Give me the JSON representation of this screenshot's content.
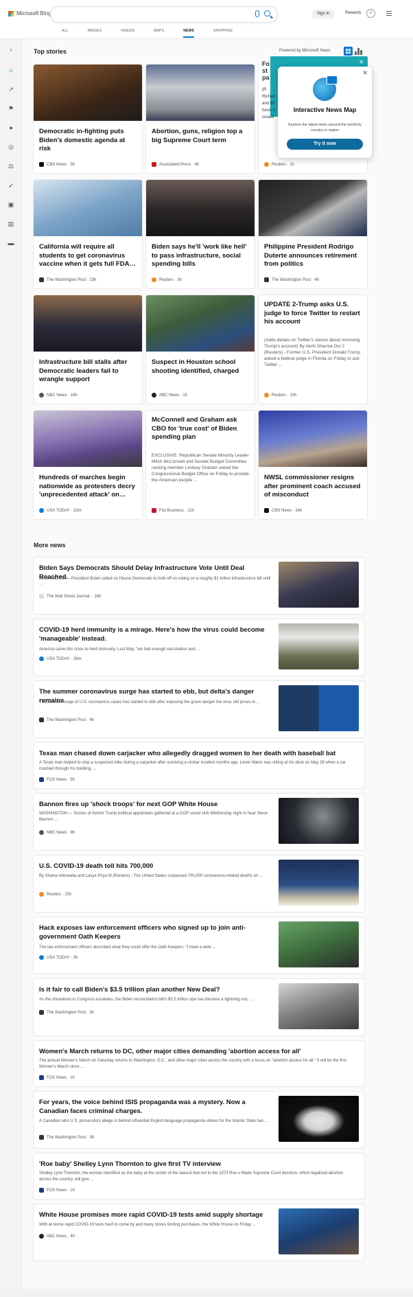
{
  "header": {
    "logo": "Microsoft Bing",
    "signin": "Sign in",
    "rewards": "Rewards",
    "tabs": [
      "ALL",
      "IMAGES",
      "VIDEOS",
      "MAPS",
      "NEWS",
      "SHOPPING"
    ],
    "active_tab": "NEWS"
  },
  "top": {
    "title": "Top stories",
    "powered": "Powered by Microsoft News"
  },
  "popup": {
    "title": "Interactive News Map",
    "desc": "Explore the latest news around the world by country or region",
    "button": "Try it now"
  },
  "teal": {
    "fragments": [
      "Fo",
      "st",
      "pa",
      "(R",
      "Richan",
      "and $5",
      "funds c",
      "issued"
    ]
  },
  "cards": [
    {
      "title": "Democratic in-fighting puts Biden's domestic agenda at risk",
      "source": "CBS News · 3h"
    },
    {
      "title": "Abortion, guns, religion top a big Supreme Court term",
      "source": "Associated Press · 4h"
    },
    {
      "title": "",
      "source": "Reuters · 1h"
    },
    {
      "title": "California will require all students to get coronavirus vaccine when it gets full FDA…",
      "source": "The Washington Post · 23h"
    },
    {
      "title": "Biden says he'll 'work like hell' to pass infrastructure, social spending bills",
      "source": "Reuters · 3h"
    },
    {
      "title": "Philippine President Rodrigo Duterte announces retirement from politics",
      "source": "The Washington Post · 4h"
    },
    {
      "title": "Infrastructure bill stalls after Democratic leaders fail to wrangle support",
      "source": "NBC News · 16h"
    },
    {
      "title": "Suspect in Houston school shooting identified, charged",
      "source": "ABC News · 1h"
    },
    {
      "title": "UPDATE 2-Trump asks U.S. judge to force Twitter to restart his account",
      "snippet": "(Adds details on Twitter's stance about removing Trump's account) By Akriti Sharma Oct 2 (Reuters) - Former U.S. President Donald Trump asked a federal judge in Florida on Friday to ask Twitter ...",
      "source": "Reuters · 10h"
    },
    {
      "title": "Hundreds of marches begin nationwide as protesters decry 'unprecedented attack' on…",
      "source": "USA TODAY · 22m"
    },
    {
      "title": "McConnell and Graham ask CBO for 'true cost' of Biden spending plan",
      "snippet": "EXCLUSIVE: Republican Senate Minority Leader Mitch McConnell and Senate Budget Committee ranking member Lindsey Graham asked the Congressional Budget Office on Friday to provide the American people ...",
      "source": "Fox Business · 21h"
    },
    {
      "title": "NWSL commissioner resigns after prominent coach accused of misconduct",
      "source": "CBS News · 14h"
    }
  ],
  "more": {
    "title": "More news",
    "items": [
      {
        "title": "Biden Says Democrats Should Delay Infrastructure Vote Until Deal Reached",
        "snippet": "WASHINGTON—President Biden called on House Democrats to hold off on voting on a roughly $1 trillion infrastructure bill until ...",
        "source": "The Wall Street Journal. · 16h"
      },
      {
        "title": "COVID-19 herd immunity is a mirage. Here's how the virus could become 'manageable' instead.",
        "snippet": "America came this close to herd immunity. Last May, \"we had enough vaccination and ...",
        "source": "USA TODAY · 28m"
      },
      {
        "title": "The summer coronavirus surge has started to ebb, but delta's danger remains",
        "snippet": "The summer surge of U.S. coronavirus cases has started to ebb after exposing the grave danger the virus still poses in ...",
        "source": "The Washington Post · 6h"
      },
      {
        "title": "Texas man chased down carjacker who allegedly dragged women to her death with baseball bat",
        "snippet": "A Texas man helped to stop a suspected killer during a carjacker after surviving a similar incident months ago. Lewis Matos was sitting at his desk on May 26 when a car crashed through his building, ...",
        "source": "FOX News · 5h"
      },
      {
        "title": "Bannon fires up 'shock troops' for next GOP White House",
        "snippet": "WASHINGTON — Scores of former Trump political appointees gathered at a GOP social club Wednesday night to hear Steve Bannon ...",
        "source": "NBC News · 8h"
      },
      {
        "title": "U.S. COVID-19 death toll hits 700,000",
        "snippet": "By Shaina Ahluwalia and Lasya Priya M (Reuters) - The United States surpassed 700,000 coronavirus-related deaths on ...",
        "source": "Reuters · 22h"
      },
      {
        "title": "Hack exposes law enforcement officers who signed up to join anti-government Oath Keepers",
        "snippet": "The law enforcement officers described what they could offer the Oath Keepers: \"I have a wide ...",
        "source": "USA TODAY · 3h"
      },
      {
        "title": "Is it fair to call Biden's $3.5 trillion plan another New Deal?",
        "snippet": "As the showdown in Congress escalates, the Biden reconciliation bill's $3.5 trillion size has become a lightning rod. ...",
        "source": "The Washington Post · 5h"
      },
      {
        "title": "Women's March returns to DC, other major cities demanding 'abortion access for all'",
        "snippet": "The annual Women's March on Saturday returns to Washington, D.C., and other major cities across the country with a focus on \"abortion access for all.\" It will be the first Women's March since ...",
        "source": "FOX News · 1h"
      },
      {
        "title": "For years, the voice behind ISIS propaganda was a mystery. Now a Canadian faces criminal charges.",
        "snippet": "A Canadian who U.S. prosecutors allege is behind influential English-language propaganda videos for the Islamic State has ...",
        "source": "The Washington Post · 3h"
      },
      {
        "title": "'Roe baby' Shelley Lynn Thornton to give first TV interview",
        "snippet": "Shelley Lynn Thornton, the woman identified as the baby at the center of the lawsuit that led to the 1973 Roe v Wade Supreme Court decision, which legalized abortion across the country, will give ...",
        "source": "FOX News · 1h"
      },
      {
        "title": "White House promises more rapid COVID-19 tests amid supply shortage",
        "snippet": "With at-home rapid COVID-19 tests hard to come by and many stores limiting purchases, the White House on Friday ...",
        "source": "ABC News · 4h"
      }
    ]
  },
  "colors": {
    "accent": "#0078d4",
    "teal": "#19a8b3"
  }
}
